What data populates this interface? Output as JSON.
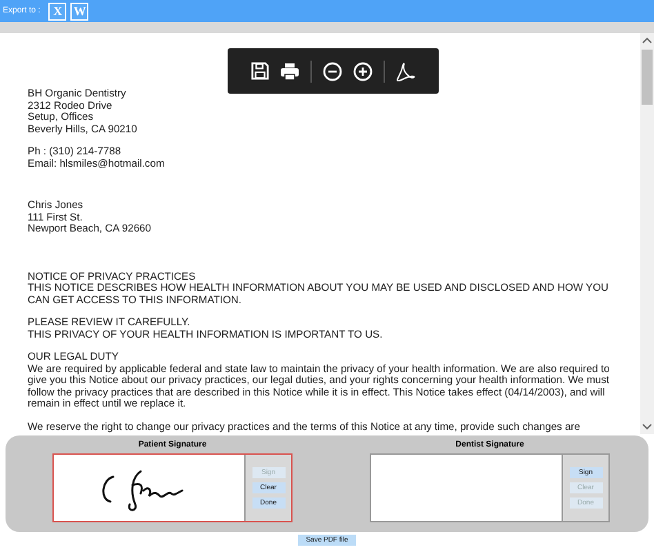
{
  "export_bar": {
    "label": "Export to :",
    "buttons": [
      "X",
      "W"
    ]
  },
  "document": {
    "sender": [
      "BH Organic Dentistry",
      "2312 Rodeo Drive",
      "Setup, Offices",
      "Beverly Hills,  CA 90210"
    ],
    "contact": [
      "Ph : (310) 214-7788",
      "Email: hlsmiles@hotmail.com"
    ],
    "recipient": [
      "Chris  Jones",
      "111 First St.",
      "Newport Beach,  CA 92660"
    ],
    "paragraphs": [
      [
        "NOTICE OF PRIVACY PRACTICES",
        "THIS NOTICE DESCRIBES HOW HEALTH INFORMATION ABOUT YOU MAY BE USED AND DISCLOSED AND HOW YOU CAN GET ACCESS TO THIS INFORMATION."
      ],
      [
        "PLEASE REVIEW IT CAREFULLY.",
        "THIS PRIVACY OF YOUR HEALTH INFORMATION IS IMPORTANT TO US."
      ],
      [
        "OUR LEGAL DUTY",
        "We are required by applicable federal and state law to maintain the privacy of your health information. We are also required to give you this Notice about our privacy practices, our legal duties, and your rights concerning your health information. We must follow the privacy practices that are described in this Notice while it is in effect. This Notice takes effect (04/14/2003), and will remain in effect until we replace it."
      ],
      [
        "We reserve the right to change our privacy practices and the terms of this Notice at any time, provide such changes are"
      ]
    ]
  },
  "signatures": [
    {
      "title": "Patient Signature",
      "active": true,
      "signed": true,
      "buttons": [
        {
          "label": "Sign",
          "disabled": true
        },
        {
          "label": "Clear",
          "disabled": false
        },
        {
          "label": "Done",
          "disabled": false
        }
      ]
    },
    {
      "title": "Dentist Signature",
      "active": false,
      "signed": false,
      "buttons": [
        {
          "label": "Sign",
          "disabled": false
        },
        {
          "label": "Clear",
          "disabled": true
        },
        {
          "label": "Done",
          "disabled": true
        }
      ]
    }
  ],
  "save_button": "Save PDF file"
}
